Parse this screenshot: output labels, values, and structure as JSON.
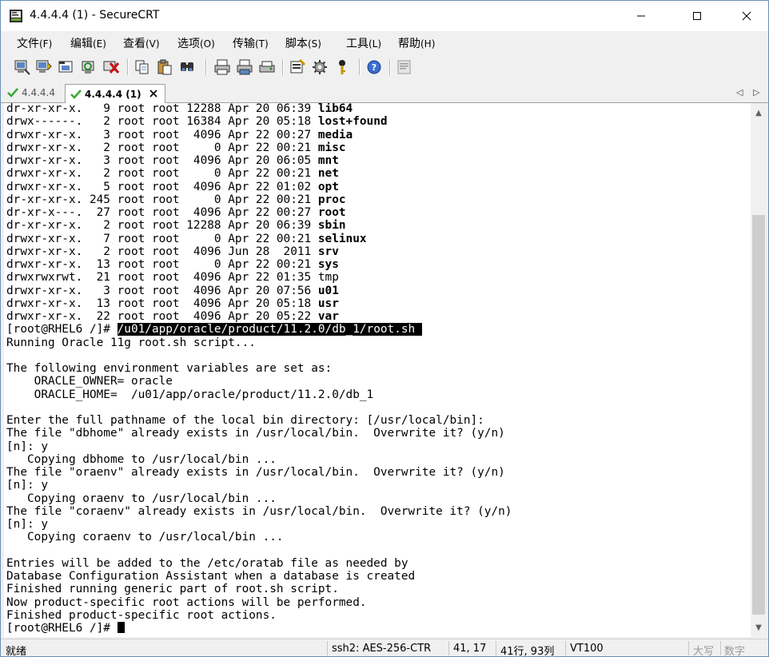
{
  "window": {
    "title": "4.4.4.4 (1) - SecureCRT"
  },
  "menu": [
    {
      "label": "文件",
      "accel": "(F)"
    },
    {
      "label": "编辑",
      "accel": "(E)"
    },
    {
      "label": "查看",
      "accel": "(V)"
    },
    {
      "label": "选项",
      "accel": "(O)"
    },
    {
      "label": "传输",
      "accel": "(T)"
    },
    {
      "label": "脚本",
      "accel": "(S)"
    },
    {
      "label": "工具",
      "accel": "(L)"
    },
    {
      "label": "帮助",
      "accel": "(H)"
    }
  ],
  "toolbar": {
    "icons": [
      "connect-icon",
      "quick-connect-icon",
      "connect-tab-icon",
      "reconnect-icon",
      "disconnect-icon",
      "copy-icon",
      "paste-icon",
      "find-icon",
      "print-icon",
      "print-selection-icon",
      "print-setup-icon",
      "session-options-icon",
      "global-options-icon",
      "keymap-icon",
      "help-icon",
      "log-icon"
    ]
  },
  "tabs": [
    {
      "label": "4.4.4.4",
      "active": false
    },
    {
      "label": "4.4.4.4 (1)",
      "active": true
    }
  ],
  "terminal": {
    "lines": [
      {
        "pre": "dr-xr-xr-x.   9 root root 12288 Apr 20 06:39 ",
        "bold": "lib64"
      },
      {
        "pre": "drwx------.   2 root root 16384 Apr 20 05:18 ",
        "bold": "lost+found"
      },
      {
        "pre": "drwxr-xr-x.   3 root root  4096 Apr 22 00:27 ",
        "bold": "media"
      },
      {
        "pre": "drwxr-xr-x.   2 root root     0 Apr 22 00:21 ",
        "bold": "misc"
      },
      {
        "pre": "drwxr-xr-x.   3 root root  4096 Apr 20 06:05 ",
        "bold": "mnt"
      },
      {
        "pre": "drwxr-xr-x.   2 root root     0 Apr 22 00:21 ",
        "bold": "net"
      },
      {
        "pre": "drwxr-xr-x.   5 root root  4096 Apr 22 01:02 ",
        "bold": "opt"
      },
      {
        "pre": "dr-xr-xr-x. 245 root root     0 Apr 22 00:21 ",
        "bold": "proc"
      },
      {
        "pre": "dr-xr-x---.  27 root root  4096 Apr 22 00:27 ",
        "bold": "root"
      },
      {
        "pre": "dr-xr-xr-x.   2 root root 12288 Apr 20 06:39 ",
        "bold": "sbin"
      },
      {
        "pre": "drwxr-xr-x.   7 root root     0 Apr 22 00:21 ",
        "bold": "selinux"
      },
      {
        "pre": "drwxr-xr-x.   2 root root  4096 Jun 28  2011 ",
        "bold": "srv"
      },
      {
        "pre": "drwxr-xr-x.  13 root root     0 Apr 22 00:21 ",
        "bold": "sys"
      },
      {
        "pre": "drwxrwxrwt.  21 root root  4096 Apr 22 01:35 ",
        "plain": "tmp"
      },
      {
        "pre": "drwxr-xr-x.   3 root root  4096 Apr 20 07:56 ",
        "bold": "u01"
      },
      {
        "pre": "drwxr-xr-x.  13 root root  4096 Apr 20 05:18 ",
        "bold": "usr"
      },
      {
        "pre": "drwxr-xr-x.  22 root root  4096 Apr 20 05:22 ",
        "bold": "var"
      },
      {
        "pre": "[root@RHEL6 /]# ",
        "hl": "/u01/app/oracle/product/11.2.0/db_1/root.sh "
      },
      {
        "pre": "Running Oracle 11g root.sh script..."
      },
      {
        "pre": ""
      },
      {
        "pre": "The following environment variables are set as:"
      },
      {
        "pre": "    ORACLE_OWNER= oracle"
      },
      {
        "pre": "    ORACLE_HOME=  /u01/app/oracle/product/11.2.0/db_1"
      },
      {
        "pre": ""
      },
      {
        "pre": "Enter the full pathname of the local bin directory: [/usr/local/bin]:"
      },
      {
        "pre": "The file \"dbhome\" already exists in /usr/local/bin.  Overwrite it? (y/n)"
      },
      {
        "pre": "[n]: y"
      },
      {
        "pre": "   Copying dbhome to /usr/local/bin ..."
      },
      {
        "pre": "The file \"oraenv\" already exists in /usr/local/bin.  Overwrite it? (y/n)"
      },
      {
        "pre": "[n]: y"
      },
      {
        "pre": "   Copying oraenv to /usr/local/bin ..."
      },
      {
        "pre": "The file \"coraenv\" already exists in /usr/local/bin.  Overwrite it? (y/n)"
      },
      {
        "pre": "[n]: y"
      },
      {
        "pre": "   Copying coraenv to /usr/local/bin ..."
      },
      {
        "pre": ""
      },
      {
        "pre": "Entries will be added to the /etc/oratab file as needed by"
      },
      {
        "pre": "Database Configuration Assistant when a database is created"
      },
      {
        "pre": "Finished running generic part of root.sh script."
      },
      {
        "pre": "Now product-specific root actions will be performed."
      },
      {
        "pre": "Finished product-specific root actions."
      },
      {
        "pre": "[root@RHEL6 /]# ",
        "cursor": true
      }
    ]
  },
  "status": {
    "ready": "就绪",
    "protocol": "ssh2: AES-256-CTR",
    "cursor_pos": "41, 17",
    "size": "41行, 93列",
    "emulation": "VT100",
    "caps": "大写",
    "num": "数字"
  }
}
